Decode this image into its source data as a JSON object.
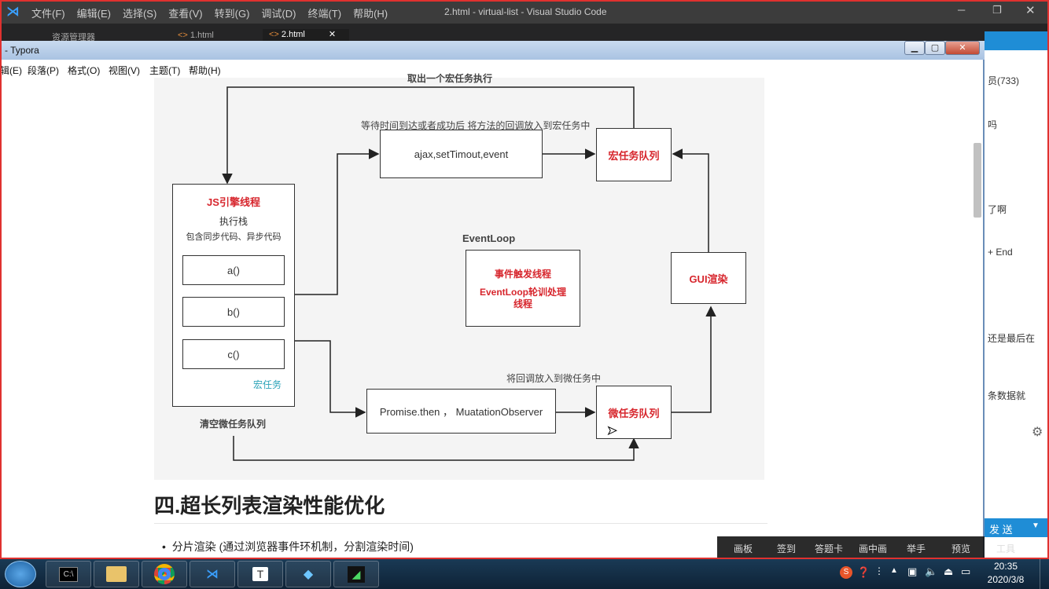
{
  "vscode": {
    "title": "2.html - virtual-list - Visual Studio Code",
    "menu": [
      "文件(F)",
      "编辑(E)",
      "选择(S)",
      "查看(V)",
      "转到(G)",
      "调试(D)",
      "终端(T)",
      "帮助(H)"
    ],
    "tabs": [
      "资源管理器",
      "1.html",
      "2.html"
    ]
  },
  "typora": {
    "title": "- Typora",
    "menu": [
      "辑(E)",
      "段落(P)",
      "格式(O)",
      "视图(V)",
      "主题(T)",
      "帮助(H)"
    ],
    "window_buttons": [
      "▁",
      "▢",
      "✕"
    ]
  },
  "diagram": {
    "top_label": "取出一个宏任务执行",
    "wait_label": "等待时间到达或者成功后 将方法的回调放入到宏任务中",
    "ajax_box": "ajax,setTimout,event",
    "macro_queue": "宏任务队列",
    "js_engine": {
      "title": "JS引擎线程",
      "sub1": "执行栈",
      "sub2": "包含同步代码、异步代码",
      "items": [
        "a()",
        "b()",
        "c()"
      ],
      "tag": "宏任务"
    },
    "eventloop_label": "EventLoop",
    "event_thread": {
      "line1": "事件触发线程",
      "line2": "EventLoop轮训处理线程"
    },
    "gui_render": "GUI渲染",
    "micro_label": "将回调放入到微任务中",
    "promise_box": "Promise.then ，  MuatationObserver",
    "micro_queue": "微任务队列",
    "clear_label": "清空微任务队列"
  },
  "content": {
    "heading": "四.超长列表渲染性能优化",
    "bullet": "分片渲染 (通过浏览器事件环机制，分割渲染时间)"
  },
  "right_panel": {
    "lines": [
      "员(733)",
      "吗",
      "了啊",
      "+ End",
      "还是最后在",
      "条数据就"
    ],
    "send": "发 送",
    "gear": "⚙"
  },
  "toolbar": [
    "画板",
    "签到",
    "答题卡",
    "画中画",
    "举手",
    "预览",
    "工具"
  ],
  "taskbar": {
    "apps": [
      "cmd",
      "files",
      "chrome",
      "vscode",
      "typora",
      "media",
      "game"
    ],
    "time": "20:35",
    "date": "2020/3/8"
  }
}
